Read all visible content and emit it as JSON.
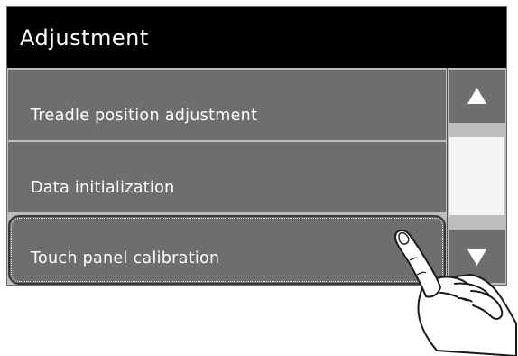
{
  "screen": {
    "title": "Adjustment",
    "menu_items": [
      {
        "label": "Treadle position adjustment"
      },
      {
        "label": "Data initialization"
      },
      {
        "label": "Touch panel calibration",
        "selected": true
      }
    ],
    "scrollbar": {
      "up_icon": "triangle-up-icon",
      "down_icon": "triangle-down-icon"
    }
  },
  "overlay": {
    "pointer_icon": "hand-pointer-icon"
  },
  "colors": {
    "titlebar": "#000000",
    "item_bg": "#6e6e6e",
    "text": "#ffffff",
    "separator": "#bdbdbd",
    "scroll_thumb": "#f4f4f4"
  }
}
